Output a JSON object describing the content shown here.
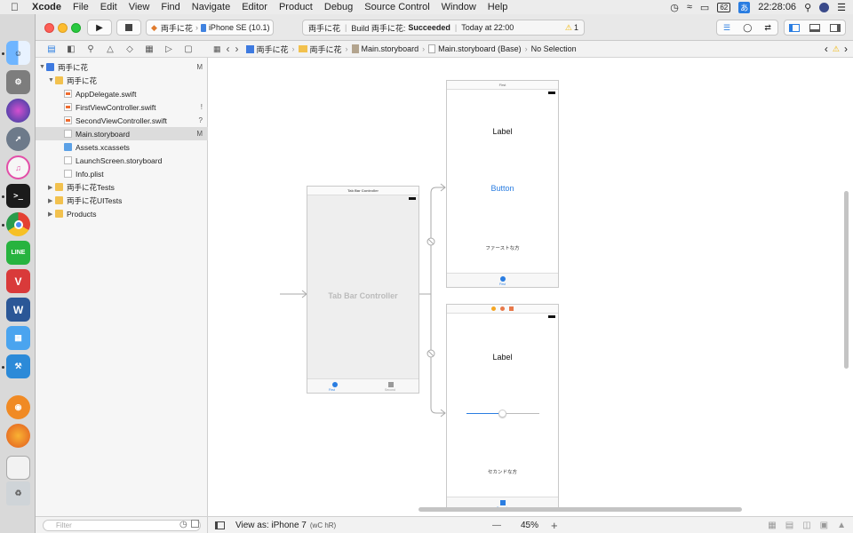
{
  "menubar": {
    "app": "Xcode",
    "items": [
      "File",
      "Edit",
      "View",
      "Find",
      "Navigate",
      "Editor",
      "Product",
      "Debug",
      "Source Control",
      "Window",
      "Help"
    ],
    "battery": "62",
    "input_method": "あ",
    "clock": "22:28:06"
  },
  "dock": {
    "icons": [
      "finder-icon",
      "system-preferences-icon",
      "siri-icon",
      "launchpad-icon",
      "itunes-icon",
      "terminal-icon",
      "chrome-icon",
      "line-icon",
      "vivaldi-icon",
      "word-icon",
      "simulator-icon",
      "xcode-icon",
      "blender-icon",
      "firefox-icon",
      "preview-icon",
      "trash-icon"
    ]
  },
  "toolbar": {
    "scheme_target": "両手に花",
    "scheme_device": "iPhone SE (10.1)",
    "status_project": "両手に花",
    "status_build_prefix": "Build 両手に花:",
    "status_build_result": "Succeeded",
    "status_time": "Today at 22:00",
    "warning_count": "1"
  },
  "jumpbar": {
    "crumbs": [
      "両手に花",
      "両手に花",
      "Main.storyboard",
      "Main.storyboard (Base)",
      "No Selection"
    ]
  },
  "navigator": {
    "rows": [
      {
        "label": "両手に花",
        "badge": "M",
        "icon": "proj",
        "level": 0,
        "tri": "▼"
      },
      {
        "label": "両手に花",
        "badge": "",
        "icon": "folder",
        "level": 1,
        "tri": "▼"
      },
      {
        "label": "AppDelegate.swift",
        "badge": "",
        "icon": "swift",
        "level": 2,
        "tri": ""
      },
      {
        "label": "FirstViewController.swift",
        "badge": "!",
        "icon": "swift",
        "level": 2,
        "tri": ""
      },
      {
        "label": "SecondViewController.swift",
        "badge": "?",
        "icon": "swift",
        "level": 2,
        "tri": ""
      },
      {
        "label": "Main.storyboard",
        "badge": "M",
        "icon": "sb",
        "level": 2,
        "tri": "",
        "selected": true
      },
      {
        "label": "Assets.xcassets",
        "badge": "",
        "icon": "assets",
        "level": 2,
        "tri": ""
      },
      {
        "label": "LaunchScreen.storyboard",
        "badge": "",
        "icon": "sb",
        "level": 2,
        "tri": ""
      },
      {
        "label": "Info.plist",
        "badge": "",
        "icon": "plist",
        "level": 2,
        "tri": ""
      },
      {
        "label": "両手に花Tests",
        "badge": "",
        "icon": "folder",
        "level": 1,
        "tri": "▶"
      },
      {
        "label": "両手に花UITests",
        "badge": "",
        "icon": "folder",
        "level": 1,
        "tri": "▶"
      },
      {
        "label": "Products",
        "badge": "",
        "icon": "folder",
        "level": 1,
        "tri": "▶"
      }
    ],
    "filter_placeholder": "Filter"
  },
  "storyboard": {
    "tab_controller": {
      "header": "Tab Bar Controller",
      "title": "Tab Bar Controller",
      "tab1": "First",
      "tab2": "Second"
    },
    "first_scene": {
      "header": "First",
      "label": "Label",
      "button": "Button",
      "text": "ファーストな方",
      "tab": "First"
    },
    "second_scene": {
      "label": "Label",
      "text": "セカンドな方",
      "tab": "Second",
      "slider_value": 0.5
    }
  },
  "bottombar": {
    "view_as": "View as: iPhone 7",
    "size_class": "(wC hR)",
    "zoom_out": "—",
    "zoom": "45%",
    "zoom_in": "+"
  },
  "colors": {
    "accent": "#2a7de1",
    "success": "#1a1a1a",
    "warning": "#f0b400"
  }
}
